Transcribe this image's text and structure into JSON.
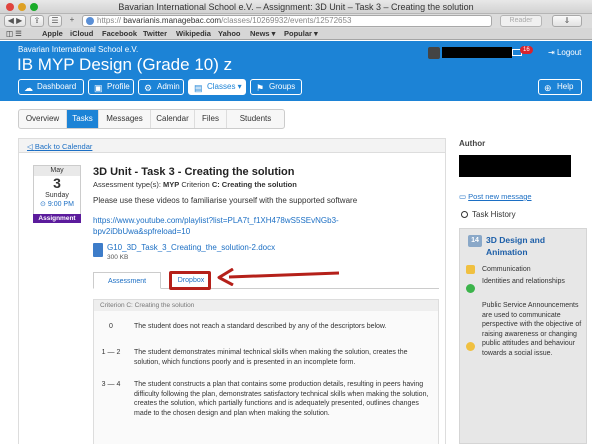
{
  "browser": {
    "title": "Bavarian International School e.V. – Assignment: 3D Unit – Task 3 – Creating the solution",
    "url_scheme": "https",
    "url_host": "bavarianis.managebac.com",
    "url_path": "/classes/10269932/events/12572653",
    "reader_label": "Reader",
    "bookmarks": [
      "Apple",
      "iCloud",
      "Facebook",
      "Twitter",
      "Wikipedia",
      "Yahoo",
      "News ▾",
      "Popular ▾"
    ]
  },
  "header": {
    "school_name": "Bavarian International School e.V.",
    "course_title": "IB MYP Design (Grade 10) z",
    "notification_count": "16",
    "logout_label": "Logout",
    "help_label": "Help",
    "nav": [
      {
        "label": "Dashboard",
        "icon": "☁"
      },
      {
        "label": "Profile",
        "icon": "▣"
      },
      {
        "label": "Admin",
        "icon": "⚙"
      },
      {
        "label": "Classes ▾",
        "icon": "▤"
      },
      {
        "label": "Groups",
        "icon": "⚑"
      }
    ]
  },
  "tabs": [
    "Overview",
    "Tasks",
    "Messages",
    "Calendar",
    "Files",
    "Students"
  ],
  "back_label": "Back to Calendar",
  "date": {
    "month": "May",
    "day": "3",
    "weekday": "Sunday",
    "time": "⊙ 9:00 PM",
    "type_label": "Assignment"
  },
  "task": {
    "title": "3D Unit - Task 3 - Creating the solution",
    "assessment_prefix": "Assessment type(s): ",
    "assessment_type": "MYP",
    "criterion_prefix": " Criterion ",
    "criterion": "C: Creating the solution",
    "description": "Please use these videos to familiarise yourself with the supported software",
    "youtube_link": "https://www.youtube.com/playlist?list=PLA7t_f1XH478wS5SEvNGb3-bpv2iDbUwa&spfreload=10",
    "file_name": "G10_3D_Task_3_Creating_the_solution-2.docx",
    "file_size": "300 KB"
  },
  "subtabs": [
    "Assessment",
    "Dropbox"
  ],
  "rubric": {
    "header": "Criterion C: Creating the solution",
    "rows": [
      {
        "level": "0",
        "text": "The student does not reach a standard described by any of the descriptors below."
      },
      {
        "level": "1 — 2",
        "text": "The student demonstrates minimal technical skills when making the solution, creates the solution, which functions poorly and is presented in an incomplete form."
      },
      {
        "level": "3 — 4",
        "text": "The student constructs a plan that contains some production details, resulting in peers having difficulty following the plan, demonstrates satisfactory technical skills when making the solution, creates the solution, which partially functions and is adequately presented, outlines changes made to the chosen design and plan when making the solution."
      }
    ]
  },
  "sidebar": {
    "author_label": "Author",
    "post_message": "Post new message",
    "task_history": "Task History",
    "unit_number": "14",
    "unit_title": "3D Design and Animation",
    "items": [
      "Communication",
      "Identities and relationships",
      "Public Service Announcements are used to communicate perspective with the objective of raising awareness or changing public attitudes and behaviour towards a social issue."
    ]
  },
  "colors": {
    "brand_blue": "#1c83d6",
    "assignment_purple": "#5b1b9c",
    "highlight_red": "#b5201a"
  }
}
